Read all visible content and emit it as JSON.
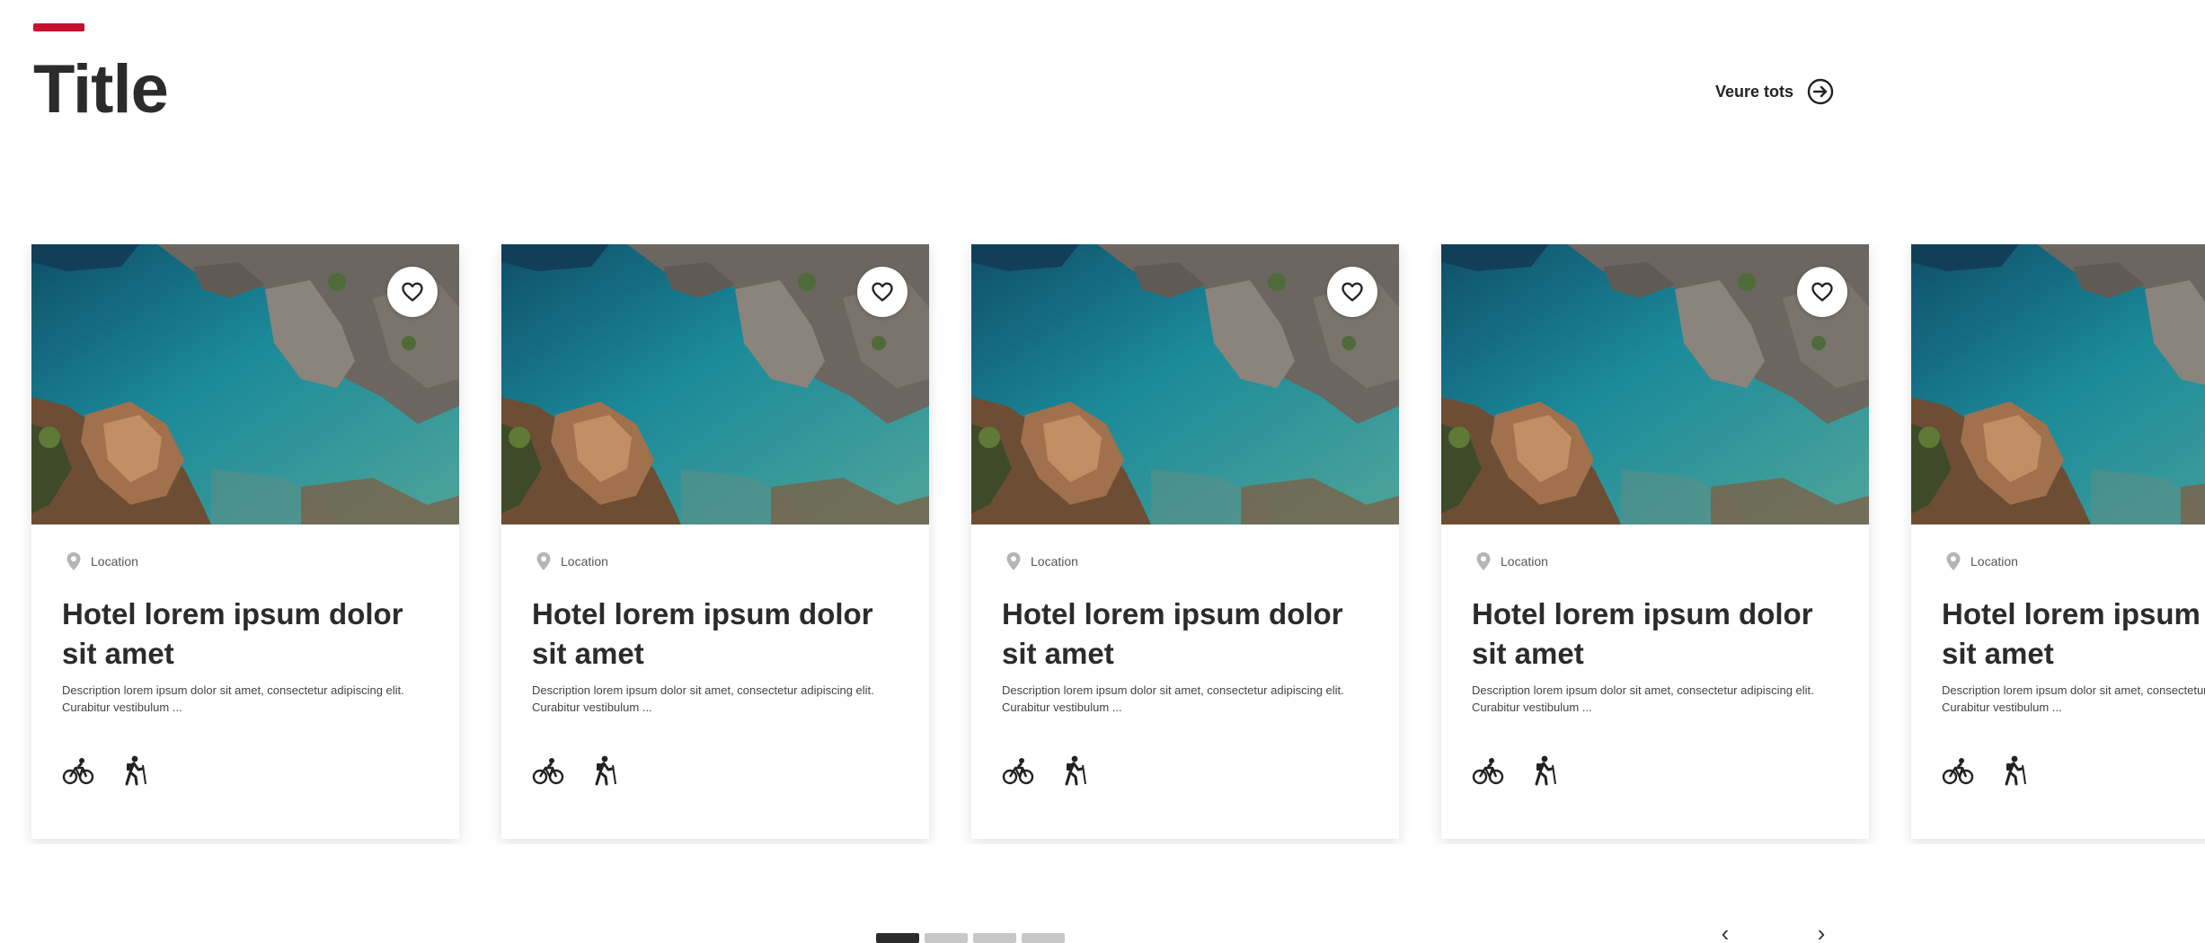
{
  "section": {
    "title": "Title",
    "see_all_label": "Veure tots",
    "see_all_icon": "arrow-right-circle-icon",
    "accent_color": "#c8102e"
  },
  "cards": [
    {
      "location": "Location",
      "title": "Hotel lorem ipsum dolor sit amet",
      "description": "Description lorem ipsum dolor sit amet, consectetur adipiscing elit. Curabitur vestibulum ...",
      "activities": [
        "bicycle-icon",
        "hiking-icon"
      ],
      "favorite_icon": "heart-icon"
    },
    {
      "location": "Location",
      "title": "Hotel lorem ipsum dolor sit amet",
      "description": "Description lorem ipsum dolor sit amet, consectetur adipiscing elit. Curabitur vestibulum ...",
      "activities": [
        "bicycle-icon",
        "hiking-icon"
      ],
      "favorite_icon": "heart-icon"
    },
    {
      "location": "Location",
      "title": "Hotel lorem ipsum dolor sit amet",
      "description": "Description lorem ipsum dolor sit amet, consectetur adipiscing elit. Curabitur vestibulum ...",
      "activities": [
        "bicycle-icon",
        "hiking-icon"
      ],
      "favorite_icon": "heart-icon"
    },
    {
      "location": "Location",
      "title": "Hotel lorem ipsum dolor sit amet",
      "description": "Description lorem ipsum dolor sit amet, consectetur adipiscing elit. Curabitur vestibulum ...",
      "activities": [
        "bicycle-icon",
        "hiking-icon"
      ],
      "favorite_icon": "heart-icon"
    },
    {
      "location": "Location",
      "title": "Hotel lorem ipsum dolor sit amet",
      "description": "Description lorem ipsum dolor sit amet, consectetur adipiscing elit. Curabitur vestibulum ...",
      "activities": [
        "bicycle-icon",
        "hiking-icon"
      ],
      "favorite_icon": "heart-icon"
    }
  ],
  "carousel": {
    "page_count": 4,
    "active_page": 1,
    "prev_icon": "chevron-left-icon",
    "next_icon": "chevron-right-icon",
    "prev_glyph": "‹",
    "next_glyph": "›"
  }
}
